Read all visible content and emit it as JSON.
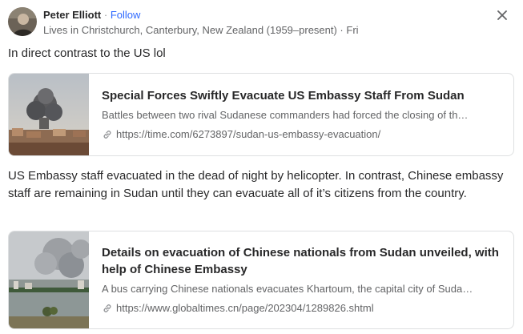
{
  "post": {
    "author": "Peter Elliott",
    "separator": "·",
    "follow_label": "Follow",
    "credential": "Lives in Christchurch, Canterbury, New Zealand (1959–present) · Fri",
    "text_1": "In direct contrast to the US lol",
    "text_2": "US Embassy staff evacuated in the dead of night by helicopter. In contrast, Chinese embassy staff are remaining in Sudan until they can evacuate all of it’s citizens from the country."
  },
  "links": [
    {
      "title": "Special Forces Swiftly Evacuate US Embassy Staff From Sudan",
      "description": "Battles between two rival Sudanese commanders had forced the closing of th…",
      "url": "https://time.com/6273897/sudan-us-embassy-evacuation/"
    },
    {
      "title": "Details on evacuation of Chinese nationals from Sudan unveiled, with help of Chinese Embassy",
      "description": "A bus carrying Chinese nationals evacuates Khartoum, the capital city of Suda…",
      "url": "https://www.globaltimes.cn/page/202304/1289826.shtml"
    }
  ],
  "icons": {
    "close": "close-icon",
    "link": "link-icon"
  },
  "colors": {
    "follow": "#2e69ff",
    "text": "#282829",
    "secondary": "#636466",
    "border": "#dee0e1"
  }
}
